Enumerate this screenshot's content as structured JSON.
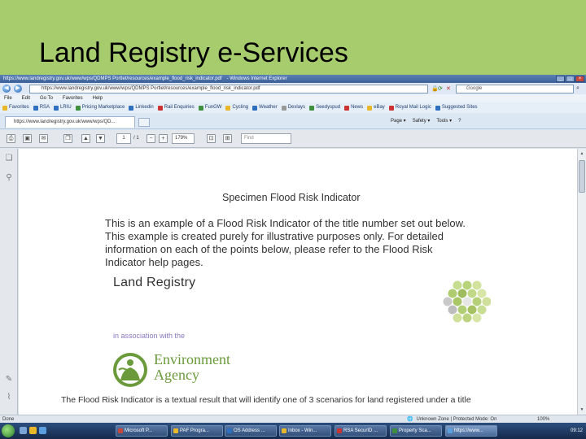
{
  "slide": {
    "title": "Land Registry e-Services"
  },
  "window": {
    "title_url": "https://www.landregistry.gov.uk/www/wps/QDMPS Portlet/resources/example_flood_risk_indicator.pdf",
    "title_app": "- Windows Internet Explorer",
    "min_label": "_",
    "max_label": "□",
    "close_label": "×"
  },
  "address_bar": {
    "back_label": "◀",
    "forward_label": "▶",
    "url": "https://www.landregistry.gov.uk/www/wps/QDMPS Portlet/resources/example_flood_risk_indicator.pdf",
    "search_placeholder": "Google"
  },
  "menu": {
    "items": [
      "File",
      "Edit",
      "Go To",
      "Favorites",
      "Help"
    ]
  },
  "favorites_bar": {
    "items": [
      {
        "label": "Favorites",
        "color": "#e8b829"
      },
      {
        "label": "RSA",
        "color": "#2f6fbf"
      },
      {
        "label": "LRIU",
        "color": "#2f6fbf"
      },
      {
        "label": "Pricing Marketplace",
        "color": "#3f8f3f"
      },
      {
        "label": "Linkedin",
        "color": "#2f6fbf"
      },
      {
        "label": "Rail Enquiries",
        "color": "#c33"
      },
      {
        "label": "FunGW",
        "color": "#3f8f3f"
      },
      {
        "label": "Cycling",
        "color": "#e8b829"
      },
      {
        "label": "Weather",
        "color": "#2f6fbf"
      },
      {
        "label": "Dexlays",
        "color": "#999"
      },
      {
        "label": "Seedyspud",
        "color": "#3f8f3f"
      },
      {
        "label": "News",
        "color": "#c33"
      },
      {
        "label": "eBay",
        "color": "#e8b829"
      },
      {
        "label": "Royal Mail Logic",
        "color": "#c33"
      },
      {
        "label": "Suggested Sites",
        "color": "#2f6fbf"
      }
    ]
  },
  "tabs": {
    "active_label": "https://www.landregistry.gov.uk/www/wps/QD...",
    "commands": [
      "Page ▾",
      "Safety ▾",
      "Tools ▾",
      "?"
    ]
  },
  "pdf_toolbar": {
    "page_current": "1",
    "page_total": "/ 1",
    "zoom": "179%",
    "find_placeholder": "Find"
  },
  "document": {
    "heading": "Specimen Flood Risk Indicator",
    "paragraph_lines": [
      "This is an example of a Flood Risk Indicator of the title number set out below.",
      "This example is created purely for illustrative purposes only. For detailed",
      "information on each of the points below, please refer to the Flood Risk",
      "Indicator help pages."
    ],
    "land_registry_logo": "Land Registry",
    "association_text": "in association with the",
    "ea_logo_line1": "Environment",
    "ea_logo_line2": "Agency",
    "bottom_text": "The Flood Risk Indicator is a textual result that will identify one of 3 scenarios for land registered under a title"
  },
  "status_bar": {
    "left": "Done",
    "zone": "Unknown Zone | Protected Mode: On",
    "zoom": "100%"
  },
  "taskbar": {
    "items": [
      {
        "label": "Microsoft P..."
      },
      {
        "label": "PAF Progra..."
      },
      {
        "label": "OS Address ..."
      },
      {
        "label": "Inbox - Win..."
      },
      {
        "label": "RSA SecurID ..."
      },
      {
        "label": "Property Sca..."
      },
      {
        "label": "https://www..."
      }
    ],
    "clock": "09:12"
  },
  "colors": {
    "slide_bg": "#a6cc6e",
    "ea_green": "#6a9a3a",
    "assoc_purple": "#8a78c0"
  }
}
